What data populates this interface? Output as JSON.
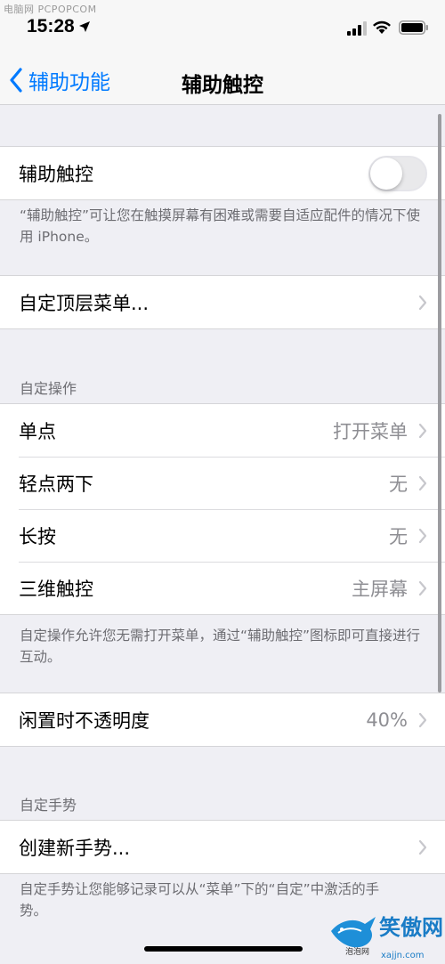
{
  "watermark_top": "电脑网 PCPOPCOM",
  "status": {
    "time": "15:28"
  },
  "nav": {
    "back_label": "辅助功能",
    "title": "辅助触控"
  },
  "assistive_touch": {
    "label": "辅助触控",
    "enabled": false,
    "footer": "“辅助触控”可让您在触摸屏幕有困难或需要自适应配件的情况下使用 iPhone。"
  },
  "top_menu": {
    "label": "自定顶层菜单..."
  },
  "custom_actions": {
    "header": "自定操作",
    "rows": [
      {
        "label": "单点",
        "value": "打开菜单"
      },
      {
        "label": "轻点两下",
        "value": "无"
      },
      {
        "label": "长按",
        "value": "无"
      },
      {
        "label": "三维触控",
        "value": "主屏幕"
      }
    ],
    "footer": "自定操作允许您无需打开菜单，通过“辅助触控”图标即可直接进行互动。"
  },
  "idle_opacity": {
    "label": "闲置时不透明度",
    "value": "40%"
  },
  "custom_gestures": {
    "header": "自定手势",
    "create_label": "创建新手势...",
    "footer": "自定手势让您能够记录可以从“菜单”下的“自定”中激活的手势。"
  },
  "watermark_logo": {
    "brand": "笑傲网",
    "sub": "泡泡网 PCPOP.COM",
    "url": "xajjn.com"
  },
  "colors": {
    "accent": "#007aff",
    "background": "#efeff4",
    "secondary_text": "#8e8e93"
  }
}
